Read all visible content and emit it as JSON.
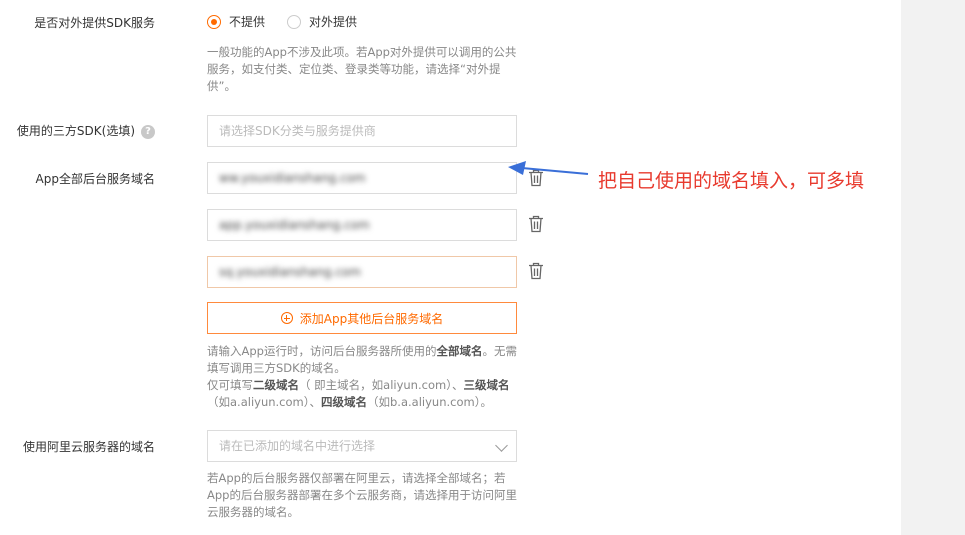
{
  "sdk_service": {
    "label": "是否对外提供SDK服务",
    "options": [
      {
        "label": "不提供",
        "checked": true
      },
      {
        "label": "对外提供",
        "checked": false
      }
    ],
    "help": "一般功能的App不涉及此项。若App对外提供可以调用的公共服务，如支付类、定位类、登录类等功能，请选择“对外提供”。"
  },
  "third_party_sdk": {
    "label": "使用的三方SDK(选填)",
    "placeholder": "请选择SDK分类与服务提供商"
  },
  "backend_domains": {
    "label": "App全部后台服务域名",
    "values": [
      "ww.youxidianshang.com",
      "app.youxidianshang.com",
      "sq.youxidianshang.com"
    ],
    "add_button": "添加App其他后台服务域名",
    "help_line1": "请输入App运行时，访问后台服务器所使用的",
    "help_bold1": "全部域名",
    "help_line1b": "。无需填写调用三方SDK的域名。",
    "help_line2a": "仅可填写",
    "help_bold2": "二级域名",
    "help_line2b": "（ 即主域名，如aliyun.com）、",
    "help_bold3": "三级域名",
    "help_line2c": "（如a.aliyun.com）、",
    "help_bold4": "四级域名",
    "help_line2d": "（如b.a.aliyun.com）。"
  },
  "aliyun_domains": {
    "label": "使用阿里云服务器的域名",
    "placeholder": "请在已添加的域名中进行选择",
    "help": "若App的后台服务器仅部署在阿里云，请选择全部域名；若App的后台服务器部署在多个云服务商，请选择用于访问阿里云服务器的域名。"
  },
  "annotation": "把自己使用的域名填入，可多填",
  "colors": {
    "accent": "#ff6a00",
    "annotation_red": "#e83a2e",
    "arrow_blue": "#3a6fd8"
  }
}
